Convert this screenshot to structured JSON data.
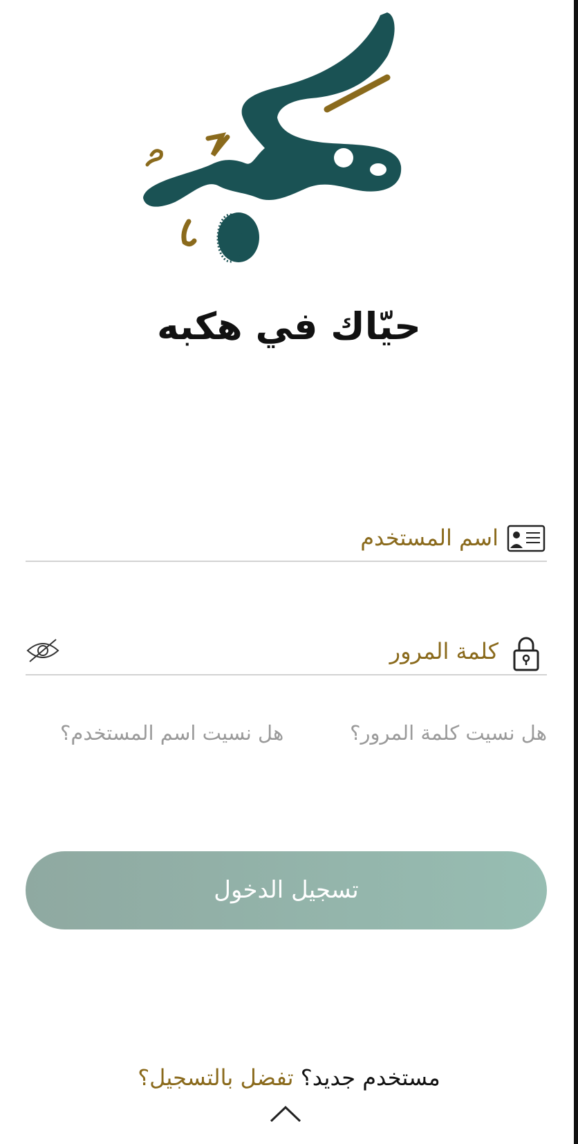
{
  "welcome": {
    "title": "حيّاك في هكبه"
  },
  "form": {
    "username": {
      "label": "اسم المستخدم",
      "icon": "id-card-icon"
    },
    "password": {
      "label": "كلمة المرور",
      "icon": "lock-icon",
      "toggle_icon": "eye-off-icon"
    }
  },
  "links": {
    "forgot_password": "هل نسيت كلمة المرور؟",
    "forgot_username": "هل نسيت اسم المستخدم؟"
  },
  "login_button": {
    "label": "تسجيل الدخول"
  },
  "signup": {
    "prompt": "مستخدم جديد؟",
    "link": "تفضل بالتسجيل؟"
  },
  "colors": {
    "brand_teal": "#1a5254",
    "brand_gold": "#8a6a1c",
    "button": "#93b3aa"
  }
}
